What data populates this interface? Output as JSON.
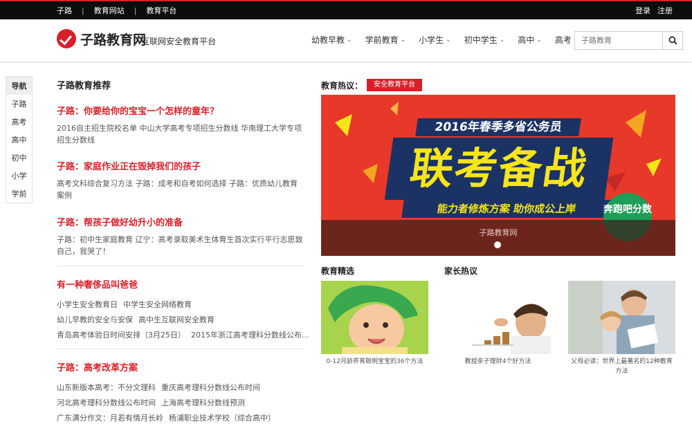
{
  "topbar": {
    "links": [
      "子路",
      "教育网站",
      "教育平台"
    ],
    "separator": "|",
    "login": "登录",
    "register": "注册"
  },
  "header": {
    "logo_text": "子路教育网",
    "slogan": "互联网安全教育平台",
    "nav": [
      "幼教早教",
      "学前教育",
      "小学生",
      "初中学生",
      "高中",
      "高考"
    ],
    "search_placeholder": "子路教育",
    "icons": {
      "search": "search-icon",
      "chevron": "chevron-down-icon"
    }
  },
  "sidenav": {
    "head": "导航",
    "items": [
      "子路",
      "高考",
      "高中",
      "初中",
      "小学",
      "学前"
    ]
  },
  "recommend": {
    "section_title": "子路教育推荐",
    "articles": [
      {
        "title": "子路：你要给你的宝宝一个怎样的童年？",
        "summary": "2016自主招生院校名单  中山大学高考专项招生分数线  华南理工大学专项招生分数线"
      },
      {
        "title": "子路：家庭作业正在毁掉我们的孩子",
        "summary": "高考文科综合复习方法  子路：成考和自考如何选择  子路：优质幼儿教育案例"
      },
      {
        "title": "子路：帮孩子做好幼升小的准备",
        "summary": "子路：初中生家庭教育  辽宁：高考录取美术生体育生首次实行平行志愿致自己，我哭了！"
      }
    ],
    "block2": {
      "title": "有一种奢侈品叫爸爸",
      "lines": [
        [
          "小学生安全教育日",
          "中学生安全网络教育"
        ],
        [
          "幼儿早教的安全与安保",
          "高中生互联网安全教育"
        ],
        [
          "青岛高考体验日时间安排（3月25日）",
          "2015年浙江高考理科分数线公布..."
        ]
      ]
    },
    "block3": {
      "title": "子路：高考改革方案",
      "lines": [
        [
          "山东新版本高考：不分文理科",
          "重庆高考理科分数线公布时间"
        ],
        [
          "河北高考理科分数线公布时间",
          "上海高考理科分数线预测"
        ],
        [
          "广东满分作文：月若有情月长岭",
          "杨浦职业技术学校（综合高中）"
        ]
      ]
    }
  },
  "hot": {
    "label": "教育热议：",
    "tag": "安全教育平台"
  },
  "banner": {
    "headline": "2016年春季多省公务员",
    "big_text": "联考备战",
    "sub_text": "能力者修炼方案 助你成公上岸",
    "badge": "奔跑吧分数",
    "site_label": "子路教育网",
    "colors": {
      "bg": "#e8382a",
      "navy": "#1a3364",
      "yellow": "#f7e51a",
      "green": "#1e9e58"
    }
  },
  "featured": {
    "title": "教育精选",
    "caption": "0-12月龄养育聪明宝宝的36个方法"
  },
  "parents": {
    "title": "家长热议",
    "cards": [
      {
        "caption": "教授亲子理财4个好方法"
      },
      {
        "caption": "父母必读：世界上最著名的12种教育方法"
      }
    ]
  },
  "colors": {
    "accent": "#d8202a",
    "topbar": "#0d0d0d"
  }
}
